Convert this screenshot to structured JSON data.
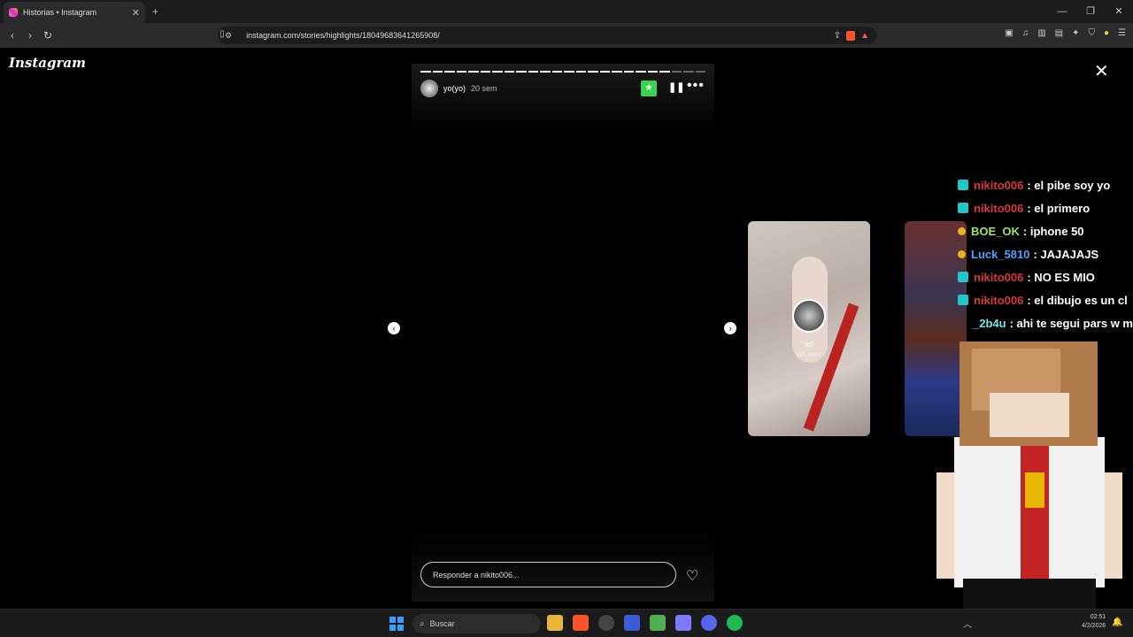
{
  "browser": {
    "tab_title": "Historias • Instagram",
    "url": "instagram.com/stories/highlights/18049683641265908/",
    "window_controls": [
      "—",
      "❐",
      "✕"
    ]
  },
  "instagram": {
    "logo": "Instagram"
  },
  "story": {
    "username": "yo(yo)",
    "age": "20 sem",
    "progress_segments": 24,
    "progress_filled": 21,
    "reply_placeholder": "Responder a nikito006..."
  },
  "next_story": {
    "name": "xd",
    "age": "66 sem"
  },
  "chat": [
    {
      "user": "nikito006",
      "text": ": el pibe soy yo",
      "color": "#d9383a",
      "badge": "cyan"
    },
    {
      "user": "nikito006",
      "text": ": el primero",
      "color": "#d9383a",
      "badge": "cyan"
    },
    {
      "user": "BOE_OK",
      "text": ": iphone 50",
      "color": "#9be36b",
      "badge": "gold"
    },
    {
      "user": "Luck_5810",
      "text": ": JAJAJAJS",
      "color": "#4aa3ff",
      "badge": "gold"
    },
    {
      "user": "nikito006",
      "text": ": NO ES MIO",
      "color": "#d9383a",
      "badge": "cyan"
    },
    {
      "user": "nikito006",
      "text": ": el dibujo es un cl",
      "color": "#d9383a",
      "badge": "cyan"
    },
    {
      "user": "_2b4u",
      "text": ": ahi te segui pars w m",
      "color": "#7fe0e0",
      "badge": "none"
    }
  ],
  "taskbar": {
    "search_label": "Buscar",
    "time": "02:51",
    "date": "4/2/2026"
  }
}
